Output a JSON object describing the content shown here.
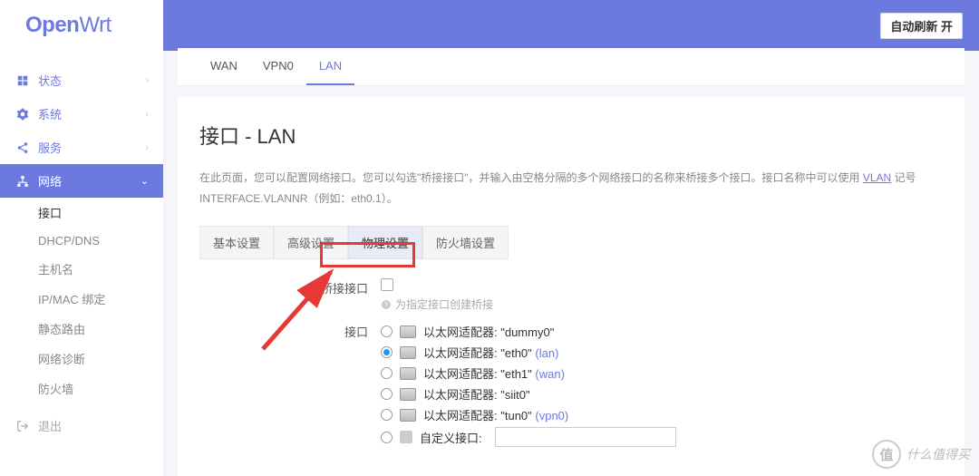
{
  "logo": {
    "main": "Open",
    "sub": "Wrt"
  },
  "autorefresh": "自动刷新 开",
  "sidebar": {
    "status": "状态",
    "system": "系统",
    "services": "服务",
    "network": "网络",
    "logout": "退出",
    "subs": {
      "interfaces": "接口",
      "dhcpdns": "DHCP/DNS",
      "hostnames": "主机名",
      "ipmac": "IP/MAC 绑定",
      "staticroutes": "静态路由",
      "diagnostics": "网络诊断",
      "firewall": "防火墙"
    }
  },
  "ifaceTabs": {
    "wan": "WAN",
    "vpn0": "VPN0",
    "lan": "LAN"
  },
  "panel": {
    "title": "接口 - LAN",
    "desc_pre": "在此页面，您可以配置网络接口。您可以勾选\"桥接接口\"，并输入由空格分隔的多个网络接口的名称来桥接多个接口。接口名称中可以使用 ",
    "desc_link": "VLAN",
    "desc_post": " 记号 INTERFACE.VLANNR（例如：eth0.1）。"
  },
  "subtabs": {
    "basic": "基本设置",
    "advanced": "高级设置",
    "physical": "物理设置",
    "firewall": "防火墙设置"
  },
  "form": {
    "bridge_label": "桥接接口",
    "bridge_hint": "为指定接口创建桥接",
    "iface_label": "接口",
    "adapter_prefix": "以太网适配器: ",
    "options": [
      {
        "name": "\"dummy0\"",
        "net": "",
        "checked": false
      },
      {
        "name": "\"eth0\"",
        "net": "(lan)",
        "checked": true
      },
      {
        "name": "\"eth1\"",
        "net": "(wan)",
        "checked": false
      },
      {
        "name": "\"siit0\"",
        "net": "",
        "checked": false
      },
      {
        "name": "\"tun0\"",
        "net": "(vpn0)",
        "checked": false
      }
    ],
    "custom_label": "自定义接口:"
  },
  "watermark": {
    "badge": "值",
    "text": "什么值得买"
  }
}
